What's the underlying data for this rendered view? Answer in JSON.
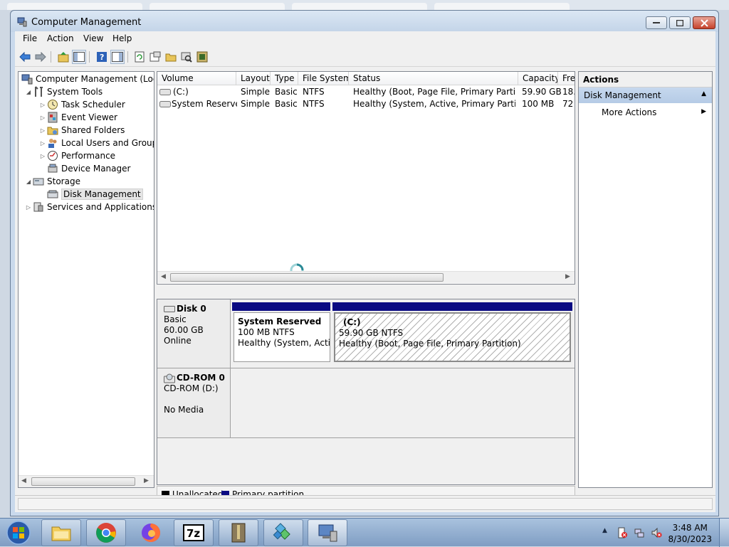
{
  "window": {
    "title": "Computer Management"
  },
  "menu": [
    "File",
    "Action",
    "View",
    "Help"
  ],
  "toolbar_icons": [
    "back-icon",
    "forward-icon",
    "up-folder-icon",
    "show-hide-tree-icon",
    "help-icon",
    "show-hide-action-icon",
    "refresh-icon",
    "properties-icon",
    "open-icon",
    "rescan-icon",
    "settings-icon"
  ],
  "tree": {
    "root": "Computer Management (Local",
    "items": [
      {
        "label": "System Tools"
      },
      {
        "label": "Task Scheduler"
      },
      {
        "label": "Event Viewer"
      },
      {
        "label": "Shared Folders"
      },
      {
        "label": "Local Users and Groups"
      },
      {
        "label": "Performance"
      },
      {
        "label": "Device Manager"
      },
      {
        "label": "Storage"
      },
      {
        "label": "Disk Management"
      },
      {
        "label": "Services and Applications"
      }
    ]
  },
  "volumes": {
    "headers": [
      "Volume",
      "Layout",
      "Type",
      "File System",
      "Status",
      "Capacity",
      "Fre"
    ],
    "rows": [
      [
        "(C:)",
        "Simple",
        "Basic",
        "NTFS",
        "Healthy (Boot, Page File, Primary Partition)",
        "59.90 GB",
        "18."
      ],
      [
        "System Reserved",
        "Simple",
        "Basic",
        "NTFS",
        "Healthy (System, Active, Primary Partition)",
        "100 MB",
        "72"
      ]
    ]
  },
  "disks": [
    {
      "name": "Disk 0",
      "type": "Basic",
      "size": "60.00 GB",
      "state": "Online",
      "partitions": [
        {
          "name": "System Reserved",
          "size": "100 MB NTFS",
          "status": "Healthy (System, Active"
        },
        {
          "name": "(C:)",
          "size": "59.90 GB NTFS",
          "status": "Healthy (Boot, Page File, Primary Partition)"
        }
      ]
    },
    {
      "name": "CD-ROM 0",
      "type": "CD-ROM (D:)",
      "state": "No Media"
    }
  ],
  "legend": [
    {
      "label": "Unallocated",
      "color": "#000000"
    },
    {
      "label": "Primary partition",
      "color": "#0a0a82"
    }
  ],
  "actions": {
    "header": "Actions",
    "section": "Disk Management",
    "item": "More Actions"
  },
  "taskbar": {
    "apps": [
      "explorer-icon",
      "chrome-icon",
      "firefox-icon",
      "7zip-icon",
      "archive-icon",
      "installer-icon",
      "computer-management-icon"
    ],
    "time": "3:48 AM",
    "date": "8/30/2023"
  },
  "colors": {
    "primary_partition": "#0a0a82",
    "selection": "#c6d8ee",
    "title_bar": "#c9d9ec"
  }
}
